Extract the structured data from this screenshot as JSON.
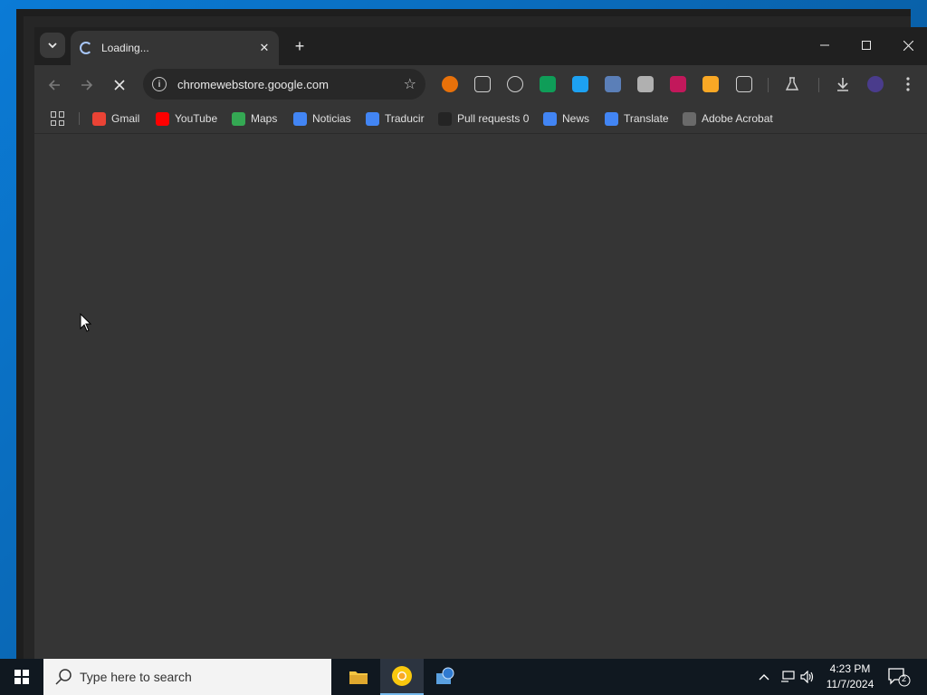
{
  "browser": {
    "tab": {
      "title": "Loading...",
      "close_label": "✕"
    },
    "new_tab_label": "+",
    "window_controls": {
      "minimize": "—",
      "maximize": "☐",
      "close": "✕"
    },
    "omnibox": {
      "url": "chromewebstore.google.com"
    },
    "bookmarks": [
      {
        "label": "Gmail",
        "icon": "gmail-icon",
        "color": "#ea4335"
      },
      {
        "label": "YouTube",
        "icon": "youtube-icon",
        "color": "#ff0000"
      },
      {
        "label": "Maps",
        "icon": "maps-icon",
        "color": "#34a853"
      },
      {
        "label": "Noticias",
        "icon": "google-news-icon",
        "color": "#4285f4"
      },
      {
        "label": "Traducir",
        "icon": "google-translate-icon",
        "color": "#4285f4"
      },
      {
        "label": "Pull requests 0",
        "icon": "github-icon",
        "color": "#242424"
      },
      {
        "label": "News",
        "icon": "google-news-icon",
        "color": "#4285f4"
      },
      {
        "label": "Translate",
        "icon": "google-translate-icon",
        "color": "#4285f4"
      },
      {
        "label": "Adobe Acrobat",
        "icon": "globe-icon",
        "color": "#6a6a6a"
      }
    ]
  },
  "taskbar": {
    "search_placeholder": "Type here to search",
    "clock_time": "4:23 PM",
    "clock_date": "11/7/2024",
    "notification_count": "2"
  },
  "colors": {
    "accent": "#a8c7fa",
    "window_bg": "#353535",
    "titlebar_bg": "#202020"
  }
}
